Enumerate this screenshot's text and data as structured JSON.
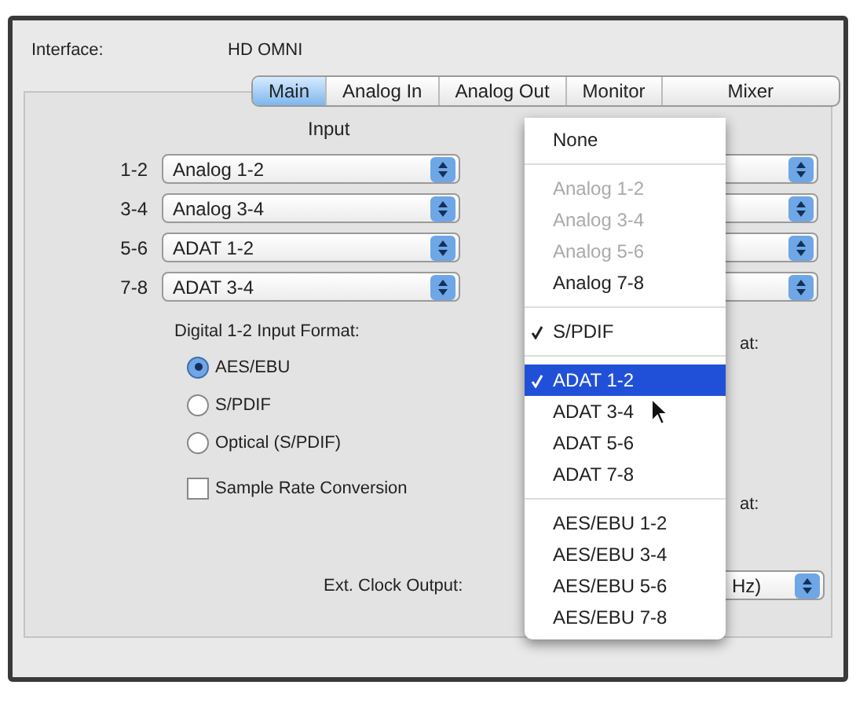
{
  "interface": {
    "label": "Interface:",
    "value": "HD OMNI"
  },
  "tabs": [
    {
      "label": "Main",
      "selected": true
    },
    {
      "label": "Analog In",
      "selected": false
    },
    {
      "label": "Analog Out",
      "selected": false
    },
    {
      "label": "Monitor",
      "selected": false
    },
    {
      "label": "Mixer",
      "selected": false
    }
  ],
  "input": {
    "title": "Input",
    "rows": [
      {
        "channel": "1-2",
        "value": "Analog 1-2"
      },
      {
        "channel": "3-4",
        "value": "Analog 3-4"
      },
      {
        "channel": "5-6",
        "value": "ADAT 1-2"
      },
      {
        "channel": "7-8",
        "value": "ADAT 3-4"
      }
    ]
  },
  "digital_format": {
    "title": "Digital 1-2 Input Format:",
    "options": [
      {
        "label": "AES/EBU",
        "selected": true
      },
      {
        "label": "S/PDIF",
        "selected": false
      },
      {
        "label": "Optical (S/PDIF)",
        "selected": false
      }
    ]
  },
  "right_labels": [
    "at:",
    "at:"
  ],
  "sample_rate_conversion": {
    "label": "Sample Rate Conversion",
    "checked": false
  },
  "clock_output": {
    "label": "Ext. Clock Output:",
    "value": "Hz)"
  },
  "menu": {
    "items": [
      {
        "kind": "item",
        "label": "None",
        "disabled": false,
        "checked": false,
        "selected": false
      },
      {
        "kind": "separator"
      },
      {
        "kind": "item",
        "label": "Analog 1-2",
        "disabled": true,
        "checked": false,
        "selected": false
      },
      {
        "kind": "item",
        "label": "Analog 3-4",
        "disabled": true,
        "checked": false,
        "selected": false
      },
      {
        "kind": "item",
        "label": "Analog 5-6",
        "disabled": true,
        "checked": false,
        "selected": false
      },
      {
        "kind": "item",
        "label": "Analog 7-8",
        "disabled": false,
        "checked": false,
        "selected": false
      },
      {
        "kind": "separator"
      },
      {
        "kind": "item",
        "label": "S/PDIF",
        "disabled": false,
        "checked": true,
        "selected": false
      },
      {
        "kind": "separator"
      },
      {
        "kind": "item",
        "label": "ADAT 1-2",
        "disabled": false,
        "checked": true,
        "selected": true
      },
      {
        "kind": "item",
        "label": "ADAT 3-4",
        "disabled": false,
        "checked": false,
        "selected": false
      },
      {
        "kind": "item",
        "label": "ADAT 5-6",
        "disabled": false,
        "checked": false,
        "selected": false
      },
      {
        "kind": "item",
        "label": "ADAT 7-8",
        "disabled": false,
        "checked": false,
        "selected": false
      },
      {
        "kind": "separator"
      },
      {
        "kind": "item",
        "label": "AES/EBU 1-2",
        "disabled": false,
        "checked": false,
        "selected": false
      },
      {
        "kind": "item",
        "label": "AES/EBU 3-4",
        "disabled": false,
        "checked": false,
        "selected": false
      },
      {
        "kind": "item",
        "label": "AES/EBU 5-6",
        "disabled": false,
        "checked": false,
        "selected": false
      },
      {
        "kind": "item",
        "label": "AES/EBU 7-8",
        "disabled": false,
        "checked": false,
        "selected": false
      }
    ]
  }
}
